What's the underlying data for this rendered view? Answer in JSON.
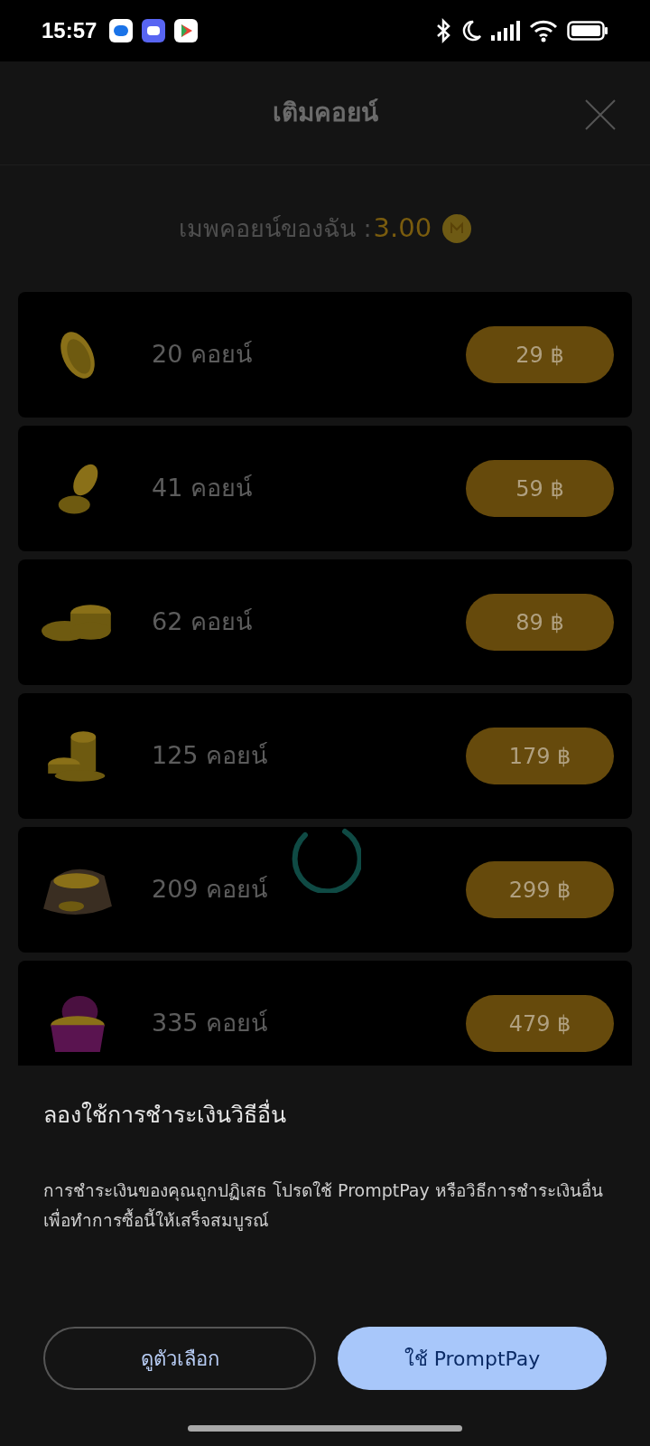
{
  "status_bar": {
    "time": "15:57"
  },
  "header": {
    "title": "เติมคอยน์"
  },
  "balance": {
    "label": "เมพคอยน์ของฉัน :",
    "amount": "3.00"
  },
  "packages": [
    {
      "coins": "20 คอยน์",
      "price": "29 ฿"
    },
    {
      "coins": "41 คอยน์",
      "price": "59 ฿"
    },
    {
      "coins": "62 คอยน์",
      "price": "89 ฿"
    },
    {
      "coins": "125 คอยน์",
      "price": "179 ฿"
    },
    {
      "coins": "209 คอยน์",
      "price": "299 ฿"
    },
    {
      "coins": "335 คอยน์",
      "price": "479 ฿"
    }
  ],
  "sheet": {
    "title": "ลองใช้การชำระเงินวิธีอื่น",
    "message": "การชำระเงินของคุณถูกปฏิเสธ โปรดใช้ PromptPay หรือวิธีการชำระเงินอื่นเพื่อทำการซื้อนี้ให้เสร็จสมบูรณ์",
    "buttons": [
      {
        "label": "ดูตัวเลือก",
        "kind": "outline"
      },
      {
        "label": "ใช้ PromptPay",
        "kind": "filled"
      }
    ]
  }
}
